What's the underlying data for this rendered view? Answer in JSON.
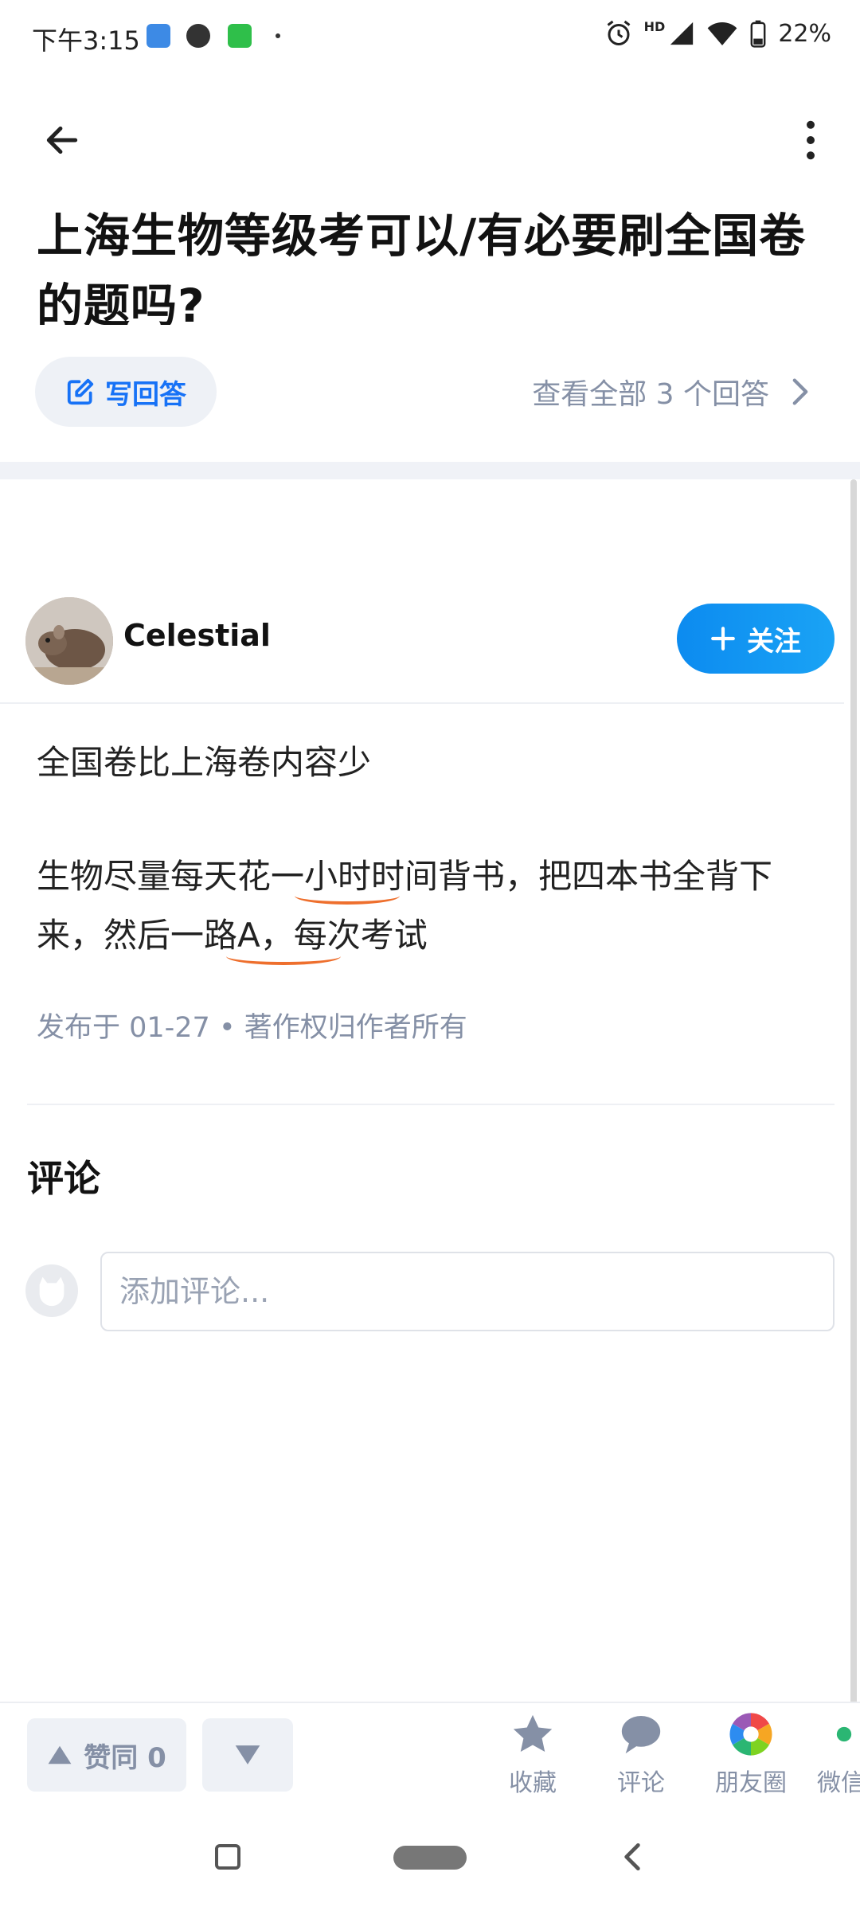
{
  "status_bar": {
    "time": "下午3:15",
    "battery": "22%",
    "network": "HD"
  },
  "header": {
    "title": "上海生物等级考可以/有必要刷全国卷的题吗?",
    "write_answer_label": "写回答",
    "view_all_label": "查看全部 3 个回答"
  },
  "answer": {
    "author": "Celestial",
    "follow_label": "关注",
    "paragraph1": "全国卷比上海卷内容少",
    "paragraph2": "生物尽量每天花一小时时间背书，把四本书全背下来，然后一路A，每次考试",
    "publish_info": "发布于 01-27 • 著作权归作者所有"
  },
  "comments": {
    "title": "评论",
    "placeholder": "添加评论..."
  },
  "bottom_bar": {
    "upvote_label": "赞同 0",
    "actions": [
      {
        "label": "收藏",
        "icon": "star-icon"
      },
      {
        "label": "评论",
        "icon": "comment-icon"
      },
      {
        "label": "朋友圈",
        "icon": "moments-icon"
      },
      {
        "label": "微信",
        "icon": "wechat-icon"
      }
    ]
  },
  "colors": {
    "accent": "#1772f6",
    "follow_gradient_start": "#0c8bf0",
    "muted": "#8590a6",
    "annotation": "#ee6f2d"
  }
}
